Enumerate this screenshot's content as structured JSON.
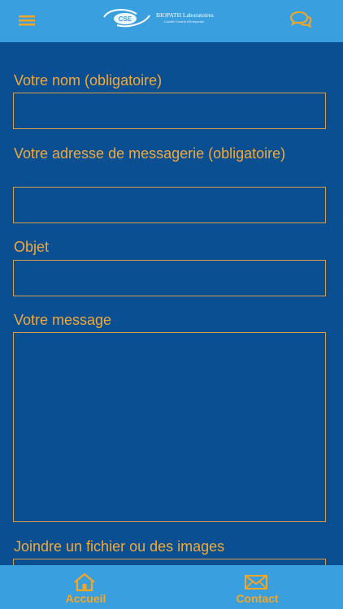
{
  "header": {
    "logo_mark": "CSE",
    "logo_title": "BIOPATH Laboratoires",
    "logo_subtitle": "Comité Central d'Entreprise",
    "menu_icon": "hamburger-menu-icon",
    "chat_icon": "chat-bubbles-icon"
  },
  "form": {
    "name_label": "Votre nom (obligatoire)",
    "name_value": "",
    "email_label": "Votre adresse de messagerie (obligatoire)",
    "email_value": "",
    "subject_label": "Objet",
    "subject_value": "",
    "message_label": "Votre message",
    "message_value": "",
    "attachment_label": "Joindre un fichier ou des images"
  },
  "bottom_nav": {
    "home_label": "Accueil",
    "home_icon": "home-icon",
    "contact_label": "Contact",
    "contact_icon": "envelope-icon"
  },
  "colors": {
    "background": "#0b4f93",
    "bar": "#3a9fde",
    "accent": "#f0a93b"
  }
}
